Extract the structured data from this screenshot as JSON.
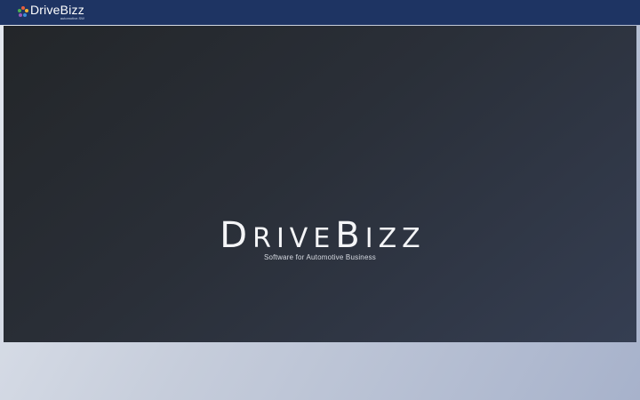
{
  "header": {
    "logo_text": "DriveBizz",
    "logo_subtext": "automotive.SW",
    "logo_dot_colors": [
      "#e95f3c",
      "#f2b632",
      "#4caf50",
      "#3b8fd9",
      "#9b59b6"
    ]
  },
  "hero": {
    "title_parts": [
      {
        "text": "D",
        "size": "big"
      },
      {
        "text": "RIVE",
        "size": "small"
      },
      {
        "text": "B",
        "size": "big"
      },
      {
        "text": "IZZ",
        "size": "small"
      }
    ],
    "title": "DriveBizz",
    "subtitle": "Software for Automotive Business"
  },
  "colors": {
    "topbar": "#1e3463",
    "hero_bg": "#2a2f38"
  }
}
